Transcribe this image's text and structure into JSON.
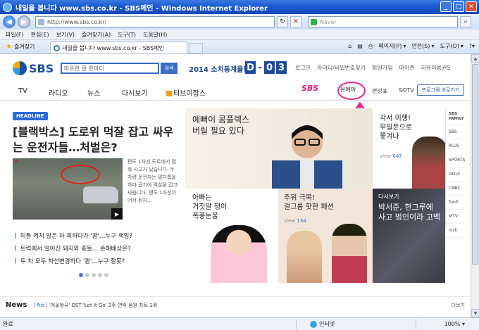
{
  "window": {
    "title": "내일을 봅니다 www.sbs.co.kr - SBS메인 - Windows Internet Explorer"
  },
  "address": {
    "url": "http://www.sbs.co.kr/",
    "search_placeholder": "Naver"
  },
  "menubar": [
    "파일(F)",
    "편집(E)",
    "보기(V)",
    "즐겨찾기(A)",
    "도구(T)",
    "도움말(H)"
  ],
  "tabs": {
    "favorites": "즐겨찾기",
    "active_tab": "내일을 봅니다 www.sbs.co.kr - SBS메인"
  },
  "commands": {
    "page": "페이지(P)",
    "safety": "안전(S)",
    "tools": "도구(O)"
  },
  "page": {
    "logo": "SBS",
    "search_value": "따뜻한 말 한마디",
    "search_button": "검색",
    "olympics": "2014 소치동계올림픽",
    "dday": {
      "d": "D",
      "dash": "-",
      "n1": "0",
      "n2": "3"
    },
    "toplinks": [
      "로그인",
      "아이디/비밀번호찾기",
      "회원가입",
      "마이존",
      "자유이용권S"
    ],
    "gnb": [
      "TV",
      "라디오",
      "뉴스",
      "다시보기",
      "티브이잡스"
    ],
    "gnb_brand": "SBS",
    "onair": "온에어",
    "schedule": "편성표",
    "sotv": "SOTV",
    "program_button": "프로그램 바로가기",
    "headline_badge": "HEADLINE",
    "headline": "[블랙박스] 도로위 먹잘 잡고 싸우는 운전자들…처벌은?",
    "thumb_caption": "",
    "desc": "편도 1차선 도로에서 접촉 사고가 났습니다. 두 차량 운전자는 말다툼을 하다 급기야 먹살을 잡고 싸움니다. 편도 1차선이어서 뒤차...",
    "bullets": [
      "미등 켜지 않은 차 피하다가 '쾅'…누구 책임?",
      "트럭에서 떨어진 돼지와 충돌… 손해배상은?",
      "두 차 모두 차선변경하다 '쾅'…누구 잘못?"
    ],
    "tile1": {
      "line1": "예뻐이 콤플렉스",
      "line2": "버릴 필요 있다"
    },
    "tile2": {
      "line1": "각서 이행!",
      "line2": "무일푼으로",
      "line3": "쫓겨나",
      "view_label": "view",
      "view_count": "647"
    },
    "tile3": {
      "line1": "아빠는",
      "line2": "거짓말 쟁이",
      "line3": "폭풍눈물"
    },
    "tile4": {
      "line1": "추위 극복!",
      "line2": "걸그룹 핫한 패션",
      "view_label": "view",
      "view_count": "134"
    },
    "tile5": {
      "caption": "다시보기",
      "line1": "박서준, 한그루에",
      "line2": "사고 범인이라 고백"
    },
    "family": [
      "SBS FAMILY",
      "SBS",
      "PLUS",
      "SPORTS",
      "GOLF",
      "CNBC",
      "funE",
      "MTV",
      "nick"
    ],
    "news": {
      "label": "News",
      "tag": "[속보]",
      "text": "'겨울왕국' OST 'Let It Go' 2주 연속 음원 차트 1위",
      "more": "더보기"
    }
  },
  "status": {
    "left": "완료",
    "zone": "인터넷",
    "zoom": "100%"
  }
}
